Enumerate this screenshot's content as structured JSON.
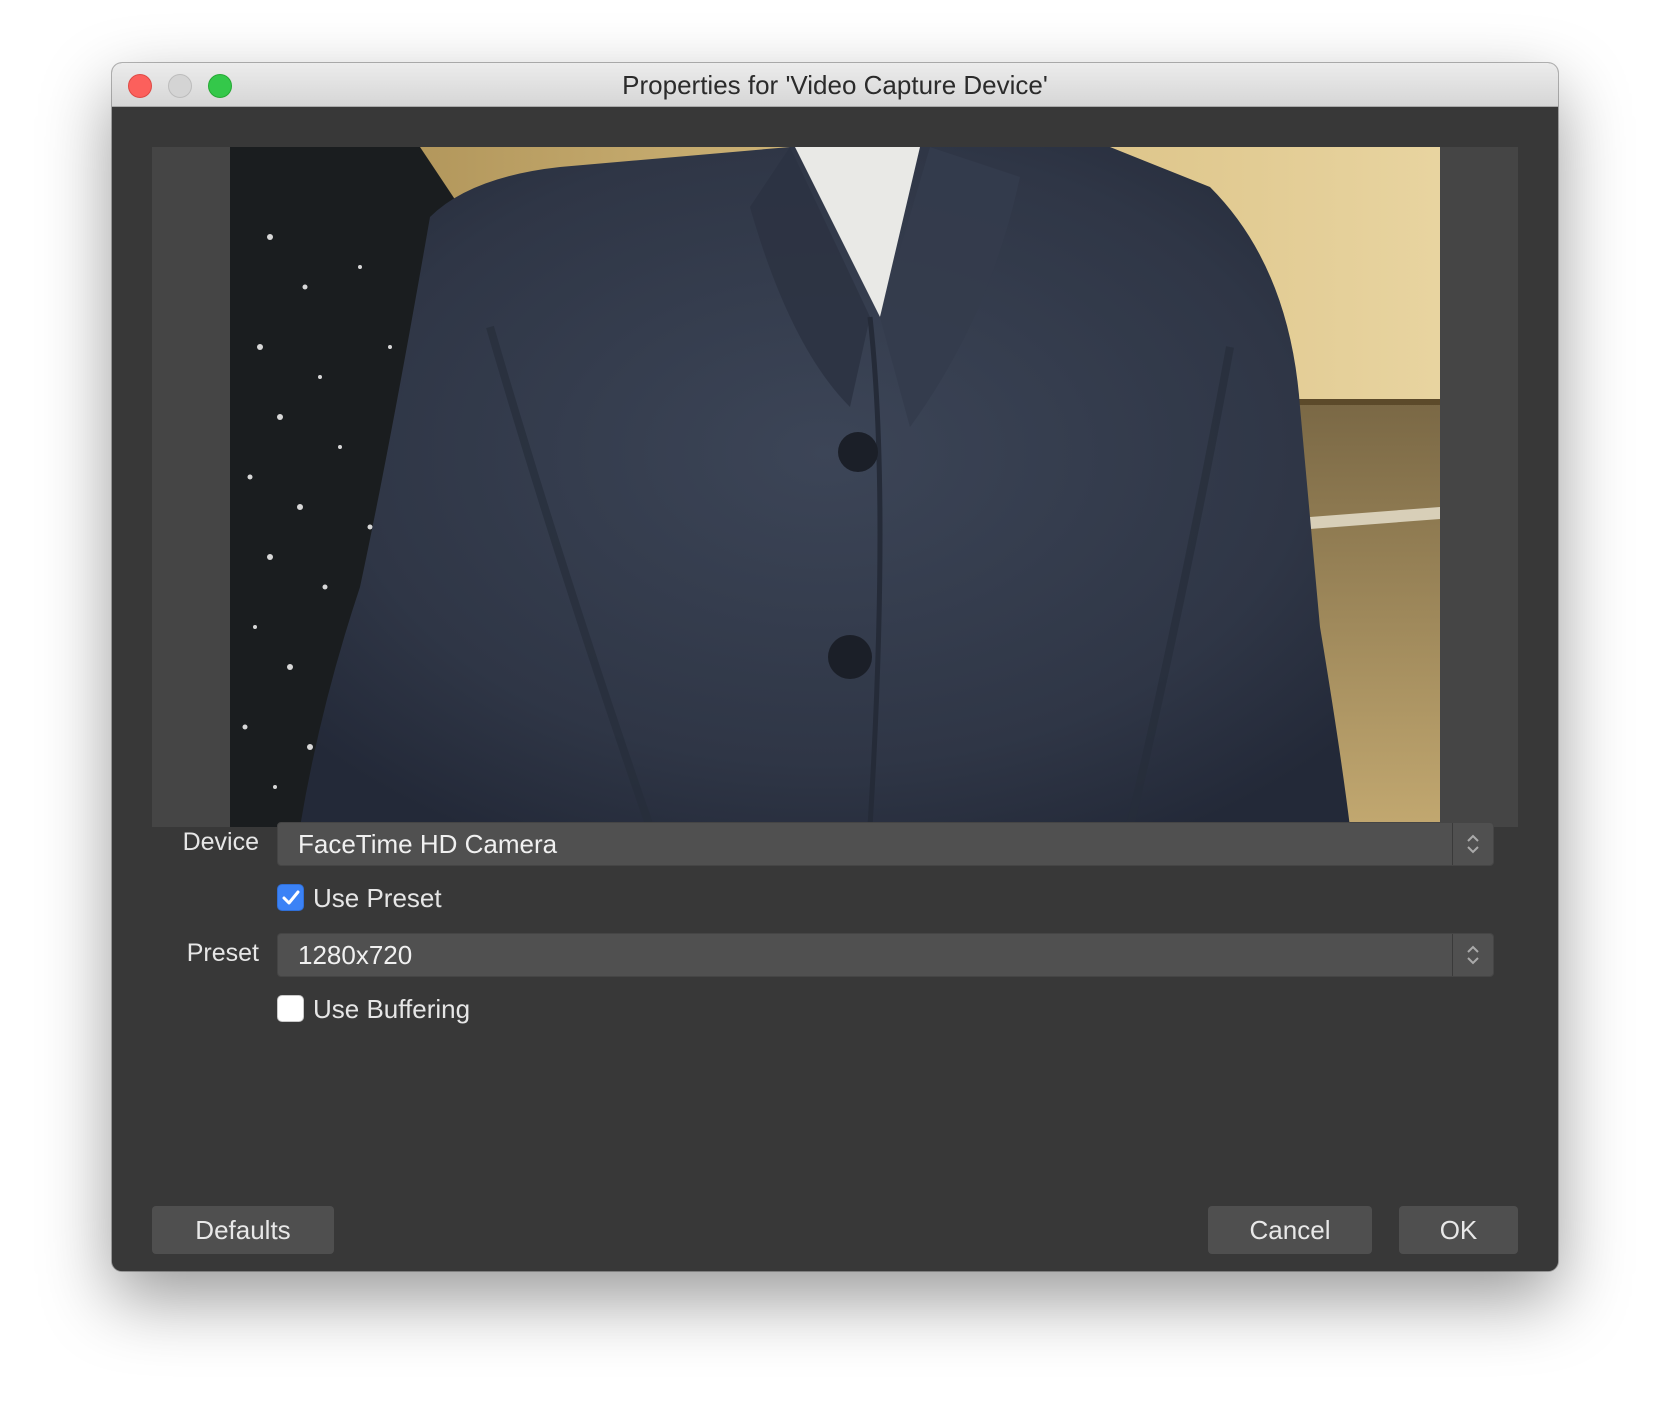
{
  "window": {
    "title": "Properties for 'Video Capture Device'"
  },
  "preview": {
    "description_icon": "webcam-preview"
  },
  "form": {
    "device_label": "Device",
    "device_value": "FaceTime HD Camera",
    "use_preset_label": "Use Preset",
    "use_preset_checked": true,
    "preset_label": "Preset",
    "preset_value": "1280x720",
    "use_buffering_label": "Use Buffering",
    "use_buffering_checked": false
  },
  "buttons": {
    "defaults": "Defaults",
    "cancel": "Cancel",
    "ok": "OK"
  },
  "colors": {
    "window_bg": "#383838",
    "checkbox_accent": "#3b82f6",
    "close": "#fc605c",
    "minimize": "#d4d4d4",
    "maximize": "#34c84a"
  }
}
